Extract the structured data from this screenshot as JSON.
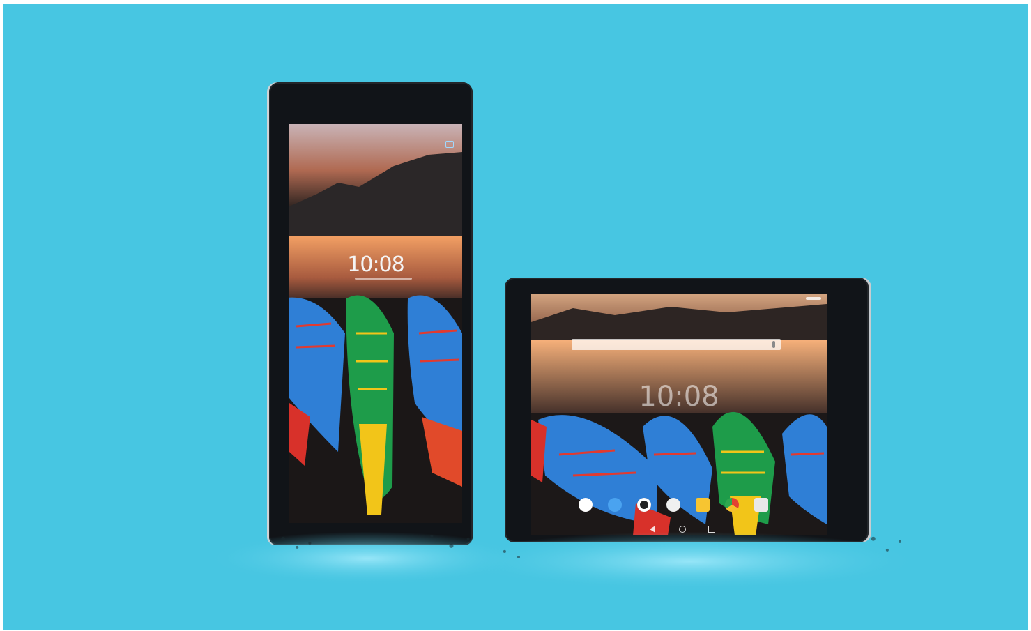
{
  "portrait_tablet": {
    "clock": "10:08",
    "icon": "camera-icon"
  },
  "landscape_tablet": {
    "clock": "10:08",
    "dock_icons": [
      "camera-icon",
      "photos-icon",
      "phone-icon",
      "contacts-icon",
      "messages-icon",
      "chrome-icon",
      "apps-icon"
    ],
    "nav_icons": [
      "back-icon",
      "home-icon",
      "recents-icon"
    ]
  },
  "colors": {
    "background": "#47c6e2",
    "boat_blue": "#2f7fd6",
    "boat_red": "#d8312a",
    "boat_yellow": "#f2c519",
    "boat_green": "#1e9c4a"
  }
}
